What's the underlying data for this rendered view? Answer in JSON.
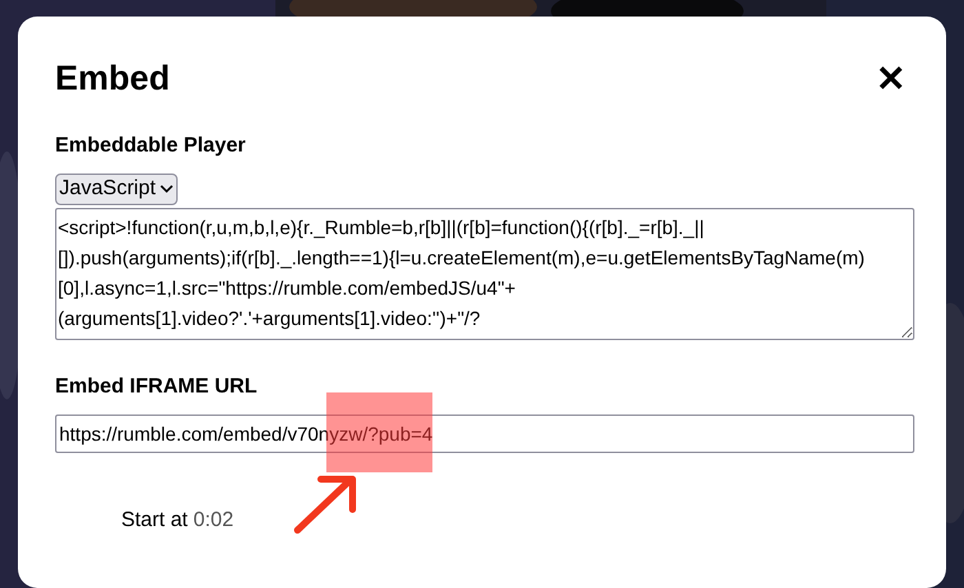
{
  "dialog": {
    "title": "Embed",
    "close_label": "✕"
  },
  "player": {
    "label": "Embeddable Player",
    "format": "JavaScript",
    "code": "<script>!function(r,u,m,b,l,e){r._Rumble=b,r[b]||(r[b]=function(){(r[b]._=r[b]._||[]).push(arguments);if(r[b]._.length==1){l=u.createElement(m),e=u.getElementsByTagName(m)[0],l.async=1,l.src=\"https://rumble.com/embedJS/u4\"+(arguments[1].video?'.'+arguments[1].video:'')+\"/?"
  },
  "iframe": {
    "label": "Embed IFRAME URL",
    "value": "https://rumble.com/embed/v70nyzw/?pub=4"
  },
  "start": {
    "label": "Start at",
    "time": "0:02"
  }
}
